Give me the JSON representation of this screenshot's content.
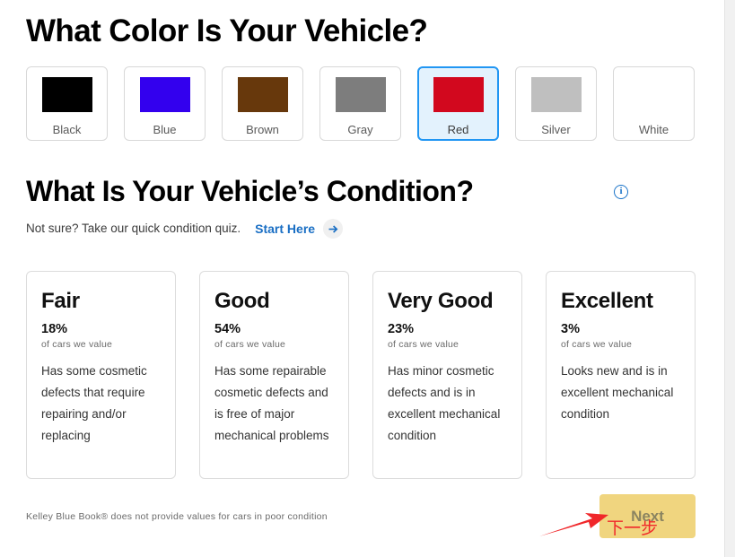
{
  "color_section": {
    "heading": "What Color Is Your Vehicle?",
    "options": [
      {
        "label": "Black",
        "hex": "#000000",
        "selected": false
      },
      {
        "label": "Blue",
        "hex": "#3300ee",
        "selected": false
      },
      {
        "label": "Brown",
        "hex": "#67380c",
        "selected": false
      },
      {
        "label": "Gray",
        "hex": "#7d7d7d",
        "selected": false
      },
      {
        "label": "Red",
        "hex": "#d2081e",
        "selected": true
      },
      {
        "label": "Silver",
        "hex": "#bfbfbf",
        "selected": false
      },
      {
        "label": "White",
        "hex": "#ffffff",
        "selected": false
      }
    ],
    "selected_value": "Red",
    "selected_border_color": "#2196f3",
    "selected_background_color": "#e3f2fd"
  },
  "condition_section": {
    "heading": "What Is Your Vehicle’s Condition?",
    "info_icon": "info-circle-icon",
    "info_icon_color": "#1a73c8",
    "quiz_prompt": "Not sure? Take our quick condition quiz.",
    "quiz_link_label": "Start Here",
    "quiz_link_color": "#1a6fc4",
    "quiz_arrow_icon": "arrow-right-icon",
    "subtext": "of cars we value",
    "cards": [
      {
        "title": "Fair",
        "percent": "18%",
        "subtext": "of cars we value",
        "description": "Has some cosmetic defects that require repairing and/or replacing"
      },
      {
        "title": "Good",
        "percent": "54%",
        "subtext": "of cars we value",
        "description": "Has some repairable cosmetic defects and is free of major mechanical problems"
      },
      {
        "title": "Very Good",
        "percent": "23%",
        "subtext": "of cars we value",
        "description": "Has minor cosmetic defects and is in excellent mechanical condition"
      },
      {
        "title": "Excellent",
        "percent": "3%",
        "subtext": "of cars we value",
        "description": "Looks new and is in excellent mechanical condition"
      }
    ]
  },
  "footer": {
    "disclaimer": "Kelley Blue Book® does not provide values for cars in poor condition",
    "next_label": "Next",
    "next_button_color": "#f0d57f",
    "next_text_color": "#8b8460"
  },
  "annotation": {
    "text": "下一步",
    "color": "#f0272a",
    "arrow_icon": "red-arrow-annotation"
  }
}
